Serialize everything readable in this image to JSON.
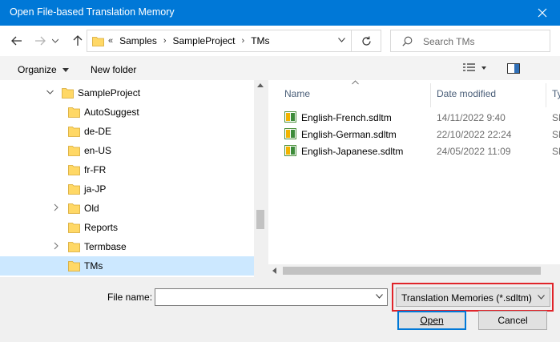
{
  "window": {
    "title": "Open File-based Translation Memory"
  },
  "address": {
    "crumbs": [
      "«",
      "Samples",
      "SampleProject",
      "TMs"
    ]
  },
  "search": {
    "placeholder": "Search TMs"
  },
  "toolbar": {
    "organize": "Organize",
    "new_folder": "New folder"
  },
  "tree": {
    "items": [
      {
        "label": "SampleProject",
        "expanded": true,
        "level": 0
      },
      {
        "label": "AutoSuggest",
        "level": 1
      },
      {
        "label": "de-DE",
        "level": 1
      },
      {
        "label": "en-US",
        "level": 1
      },
      {
        "label": "fr-FR",
        "level": 1
      },
      {
        "label": "ja-JP",
        "level": 1
      },
      {
        "label": "Old",
        "collapsed": true,
        "level": 1
      },
      {
        "label": "Reports",
        "level": 1
      },
      {
        "label": "Termbase",
        "collapsed": true,
        "level": 1
      },
      {
        "label": "TMs",
        "selected": true,
        "level": 1
      }
    ]
  },
  "list": {
    "columns": {
      "name": "Name",
      "date": "Date modified",
      "type": "Ty"
    },
    "files": [
      {
        "name": "English-French.sdltm",
        "date": "14/11/2022 9:40",
        "type": "SD"
      },
      {
        "name": "English-German.sdltm",
        "date": "22/10/2022 22:24",
        "type": "SD"
      },
      {
        "name": "English-Japanese.sdltm",
        "date": "24/05/2022 11:09",
        "type": "SD"
      }
    ]
  },
  "bottom": {
    "file_name_label": "File name:",
    "file_name_value": "",
    "file_type": "Translation Memories (*.sdltm)",
    "open_label": "Open",
    "cancel_label": "Cancel"
  },
  "colors": {
    "accent": "#0078d7",
    "highlight": "#e0242a",
    "selection": "#cce8ff",
    "folder": "#ffd866"
  }
}
